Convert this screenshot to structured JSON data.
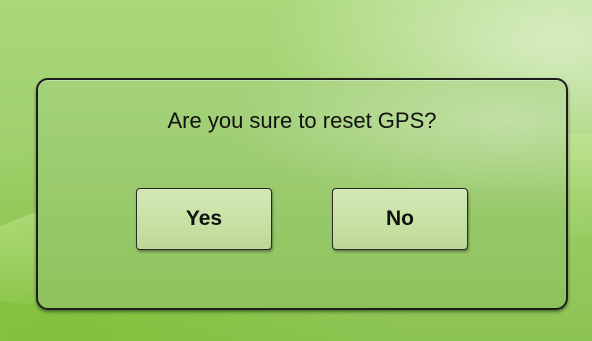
{
  "dialog": {
    "message": "Are you sure to reset GPS?",
    "yes_label": "Yes",
    "no_label": "No"
  },
  "colors": {
    "background": "#9fd06c",
    "dialog_fill": "#98c96a",
    "button_fill": "#c6e1a3",
    "border": "#1d1d1d",
    "text": "#111111"
  }
}
